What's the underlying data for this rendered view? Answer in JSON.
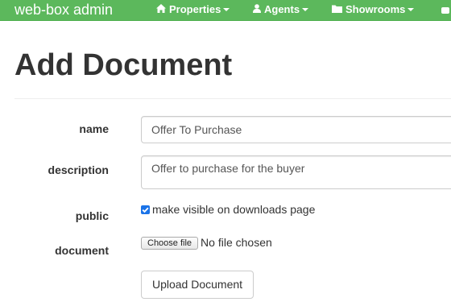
{
  "navbar": {
    "brand": "web-box admin",
    "color": "#5cb85c",
    "items": [
      {
        "label": "Properties",
        "icon": "home-icon"
      },
      {
        "label": "Agents",
        "icon": "user-icon"
      },
      {
        "label": "Showrooms",
        "icon": "folder-icon"
      }
    ]
  },
  "page": {
    "title": "Add Document"
  },
  "form": {
    "name": {
      "label": "name",
      "value": "Offer To Purchase"
    },
    "description": {
      "label": "description",
      "value": "Offer to purchase for the buyer"
    },
    "public": {
      "label": "public",
      "checked": true,
      "text": "make visible on downloads page"
    },
    "document": {
      "label": "document",
      "button": "Choose file",
      "status": "No file chosen"
    },
    "submit": "Upload Document"
  }
}
